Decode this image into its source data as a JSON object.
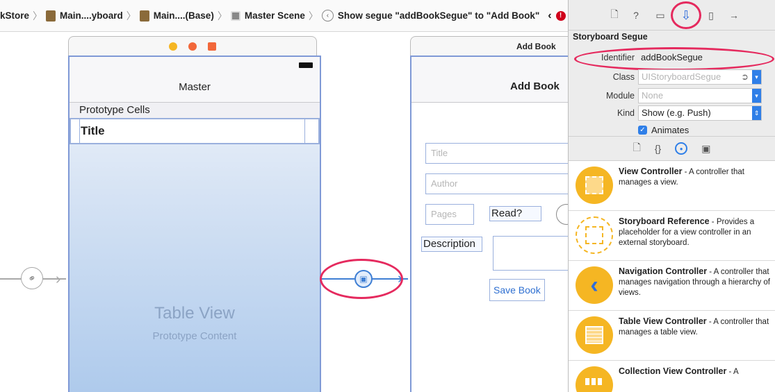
{
  "breadcrumbs": [
    {
      "label": "kStore"
    },
    {
      "label": "Main....yboard"
    },
    {
      "label": "Main....(Base)"
    },
    {
      "label": "Master Scene"
    },
    {
      "label": "Show segue \"addBookSegue\" to \"Add Book\""
    }
  ],
  "master": {
    "title": "Master",
    "prototype_header": "Prototype Cells",
    "cell_title": "Title",
    "table_caption": "Table View",
    "table_sub": "Prototype Content"
  },
  "addbook": {
    "header": "Add Book",
    "title": "Add Book",
    "title_placeholder": "Title",
    "author_placeholder": "Author",
    "pages_placeholder": "Pages",
    "read_label": "Read?",
    "description_label": "Description",
    "save_button": "Save Book"
  },
  "inspector": {
    "section_title": "Storyboard Segue",
    "identifier_label": "Identifier",
    "identifier_value": "addBookSegue",
    "class_label": "Class",
    "class_placeholder": "UIStoryboardSegue",
    "module_label": "Module",
    "module_placeholder": "None",
    "kind_label": "Kind",
    "kind_value": "Show (e.g. Push)",
    "animates_label": "Animates",
    "animates_checked": true
  },
  "library": [
    {
      "name": "View Controller",
      "desc": " - A controller that manages a view."
    },
    {
      "name": "Storyboard Reference",
      "desc": " - Provides a placeholder for a view controller in an external storyboard."
    },
    {
      "name": "Navigation Controller",
      "desc": " - A controller that manages navigation through a hierarchy of views."
    },
    {
      "name": "Table View Controller",
      "desc": " - A controller that manages a table view."
    },
    {
      "name": "Collection View Controller",
      "desc": " - A"
    }
  ],
  "colors": {
    "accent": "#2f7fe8",
    "highlight": "#e52a5e",
    "library_icon": "#f5b623"
  }
}
